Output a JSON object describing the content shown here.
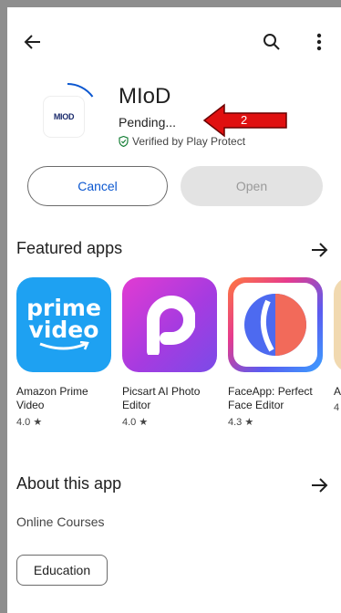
{
  "header": {
    "back_icon": "arrow-back-icon",
    "search_icon": "search-icon",
    "more_icon": "more-vert-icon"
  },
  "app": {
    "icon_text": "MIOD",
    "title": "MIoD",
    "status": "Pending...",
    "verified": "Verified by Play Protect",
    "install_progress": 0.15
  },
  "annotation": {
    "label": "2",
    "color": "#e01010"
  },
  "actions": {
    "cancel_label": "Cancel",
    "open_label": "Open"
  },
  "featured": {
    "title": "Featured apps",
    "apps": [
      {
        "name": "Amazon Prime Video",
        "rating": "4.0",
        "icon_line1": "prime",
        "icon_line2": "video"
      },
      {
        "name": "Picsart AI Photo Editor",
        "rating": "4.0"
      },
      {
        "name": "FaceApp: Perfect Face Editor",
        "rating": "4.3"
      },
      {
        "name": "A",
        "rating": "4"
      }
    ]
  },
  "about": {
    "title": "About this app",
    "description": "Online Courses",
    "category_chip": "Education"
  },
  "colors": {
    "accent": "#0b57d0",
    "verified_green": "#188038",
    "prime_blue": "#1ea1f2"
  }
}
